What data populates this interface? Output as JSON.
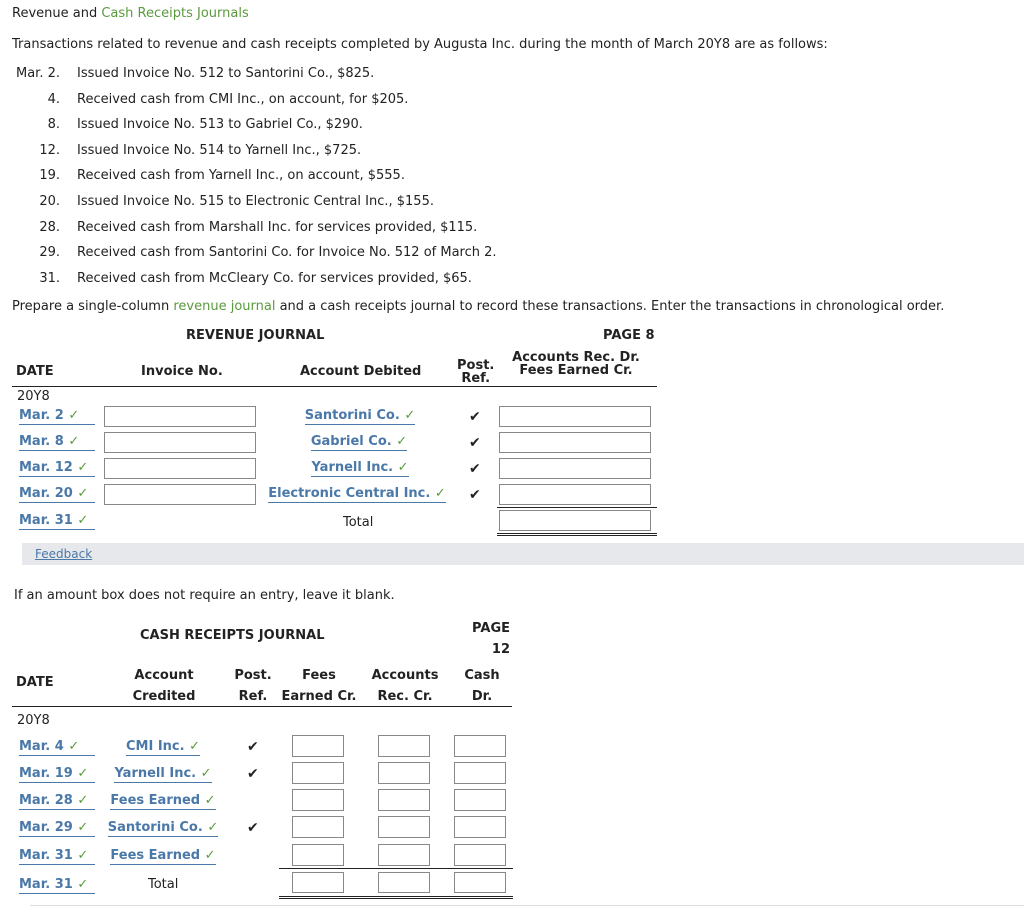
{
  "title": {
    "prefix": "Revenue and ",
    "link": "Cash Receipts Journals"
  },
  "intro": "Transactions related to revenue and cash receipts completed by Augusta Inc. during the month of March 20Y8 are as follows:",
  "transactions": [
    {
      "date": "Mar. 2.",
      "text": "Issued Invoice No. 512 to Santorini Co., $825."
    },
    {
      "date": "4.",
      "text": "Received cash from CMI Inc., on account, for $205."
    },
    {
      "date": "8.",
      "text": "Issued Invoice No. 513 to Gabriel Co., $290."
    },
    {
      "date": "12.",
      "text": "Issued Invoice No. 514 to Yarnell Inc., $725."
    },
    {
      "date": "19.",
      "text": "Received cash from Yarnell Inc., on account, $555."
    },
    {
      "date": "20.",
      "text": "Issued Invoice No. 515 to Electronic Central Inc., $155."
    },
    {
      "date": "28.",
      "text": "Received cash from Marshall Inc. for services provided, $115."
    },
    {
      "date": "29.",
      "text": "Received cash from Santorini Co. for Invoice No. 512 of March 2."
    },
    {
      "date": "31.",
      "text": "Received cash from McCleary Co. for services provided, $65."
    }
  ],
  "prepare": {
    "a": "Prepare a single-column ",
    "link": "revenue journal",
    "b": " and a cash receipts journal to record these transactions. Enter the transactions in chronological order."
  },
  "revenue_journal": {
    "title": "REVENUE JOURNAL",
    "page": "PAGE 8",
    "headers": {
      "date": "DATE",
      "invoice": "Invoice No.",
      "account": "Account Debited",
      "post1": "Post.",
      "post2": "Ref.",
      "amt1": "Accounts Rec. Dr.",
      "amt2": "Fees Earned Cr."
    },
    "year": "20Y8",
    "rows": [
      {
        "date": "Mar. 2",
        "account": "Santorini Co.",
        "post": "✔"
      },
      {
        "date": "Mar. 8",
        "account": "Gabriel Co.",
        "post": "✔"
      },
      {
        "date": "Mar. 12",
        "account": "Yarnell Inc.",
        "post": "✔"
      },
      {
        "date": "Mar. 20",
        "account": "Electronic Central Inc.",
        "post": "✔"
      }
    ],
    "total_row": {
      "date": "Mar. 31",
      "label": "Total"
    }
  },
  "feedback": "Feedback",
  "note": "If an amount box does not require an entry, leave it blank.",
  "cash_journal": {
    "title": "CASH RECEIPTS JOURNAL",
    "page1": "PAGE",
    "page2": "12",
    "headers": {
      "date": "DATE",
      "acct1": "Account",
      "acct2": "Credited",
      "post1": "Post.",
      "post2": "Ref.",
      "fees1": "Fees",
      "fees2": "Earned Cr.",
      "ar1": "Accounts",
      "ar2": "Rec. Cr.",
      "cash1": "Cash",
      "cash2": "Dr."
    },
    "year": "20Y8",
    "rows": [
      {
        "date": "Mar. 4",
        "account": "CMI Inc.",
        "post": "✔"
      },
      {
        "date": "Mar. 19",
        "account": "Yarnell Inc.",
        "post": "✔"
      },
      {
        "date": "Mar. 28",
        "account": "Fees Earned",
        "post": ""
      },
      {
        "date": "Mar. 29",
        "account": "Santorini Co.",
        "post": "✔"
      },
      {
        "date": "Mar. 31",
        "account": "Fees Earned",
        "post": ""
      }
    ],
    "total_row": {
      "date": "Mar. 31",
      "label": "Total"
    }
  },
  "check": "✓"
}
